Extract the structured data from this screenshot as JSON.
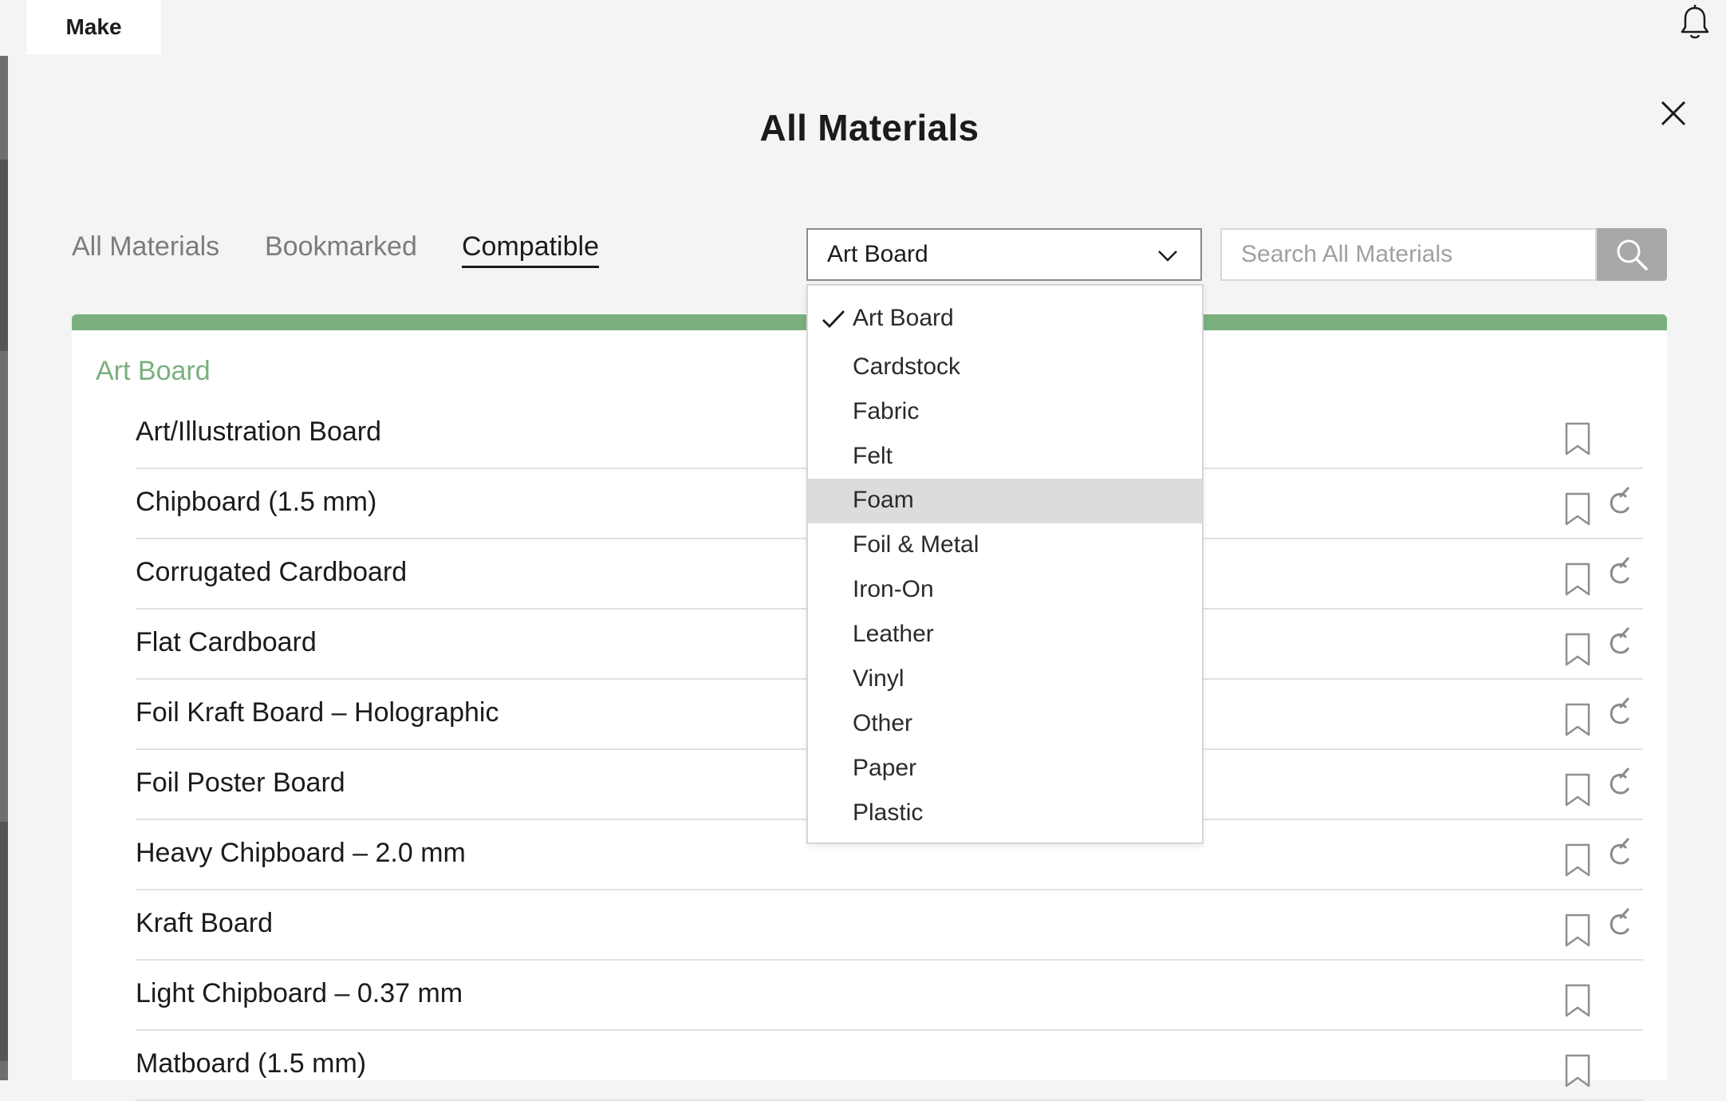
{
  "topbar": {
    "make_tab": "Make"
  },
  "modal": {
    "title": "All Materials"
  },
  "tabs": [
    {
      "label": "All Materials"
    },
    {
      "label": "Bookmarked"
    },
    {
      "label": "Compatible"
    }
  ],
  "category_select": {
    "selected": "Art Board",
    "options": [
      "Art Board",
      "Cardstock",
      "Fabric",
      "Felt",
      "Foam",
      "Foil & Metal",
      "Iron-On",
      "Leather",
      "Vinyl",
      "Other",
      "Paper",
      "Plastic"
    ],
    "hovered": "Foam"
  },
  "search": {
    "placeholder": "Search All Materials"
  },
  "accent_color": "#7ab07e",
  "section": {
    "category": "Art Board",
    "items": [
      "Art/Illustration Board",
      "Chipboard (1.5 mm)",
      "Corrugated Cardboard",
      "Flat Cardboard",
      "Foil Kraft Board  – Holographic",
      "Foil Poster Board",
      "Heavy Chipboard – 2.0 mm",
      "Kraft Board",
      "Light Chipboard – 0.37 mm",
      "Matboard (1.5 mm)"
    ]
  }
}
